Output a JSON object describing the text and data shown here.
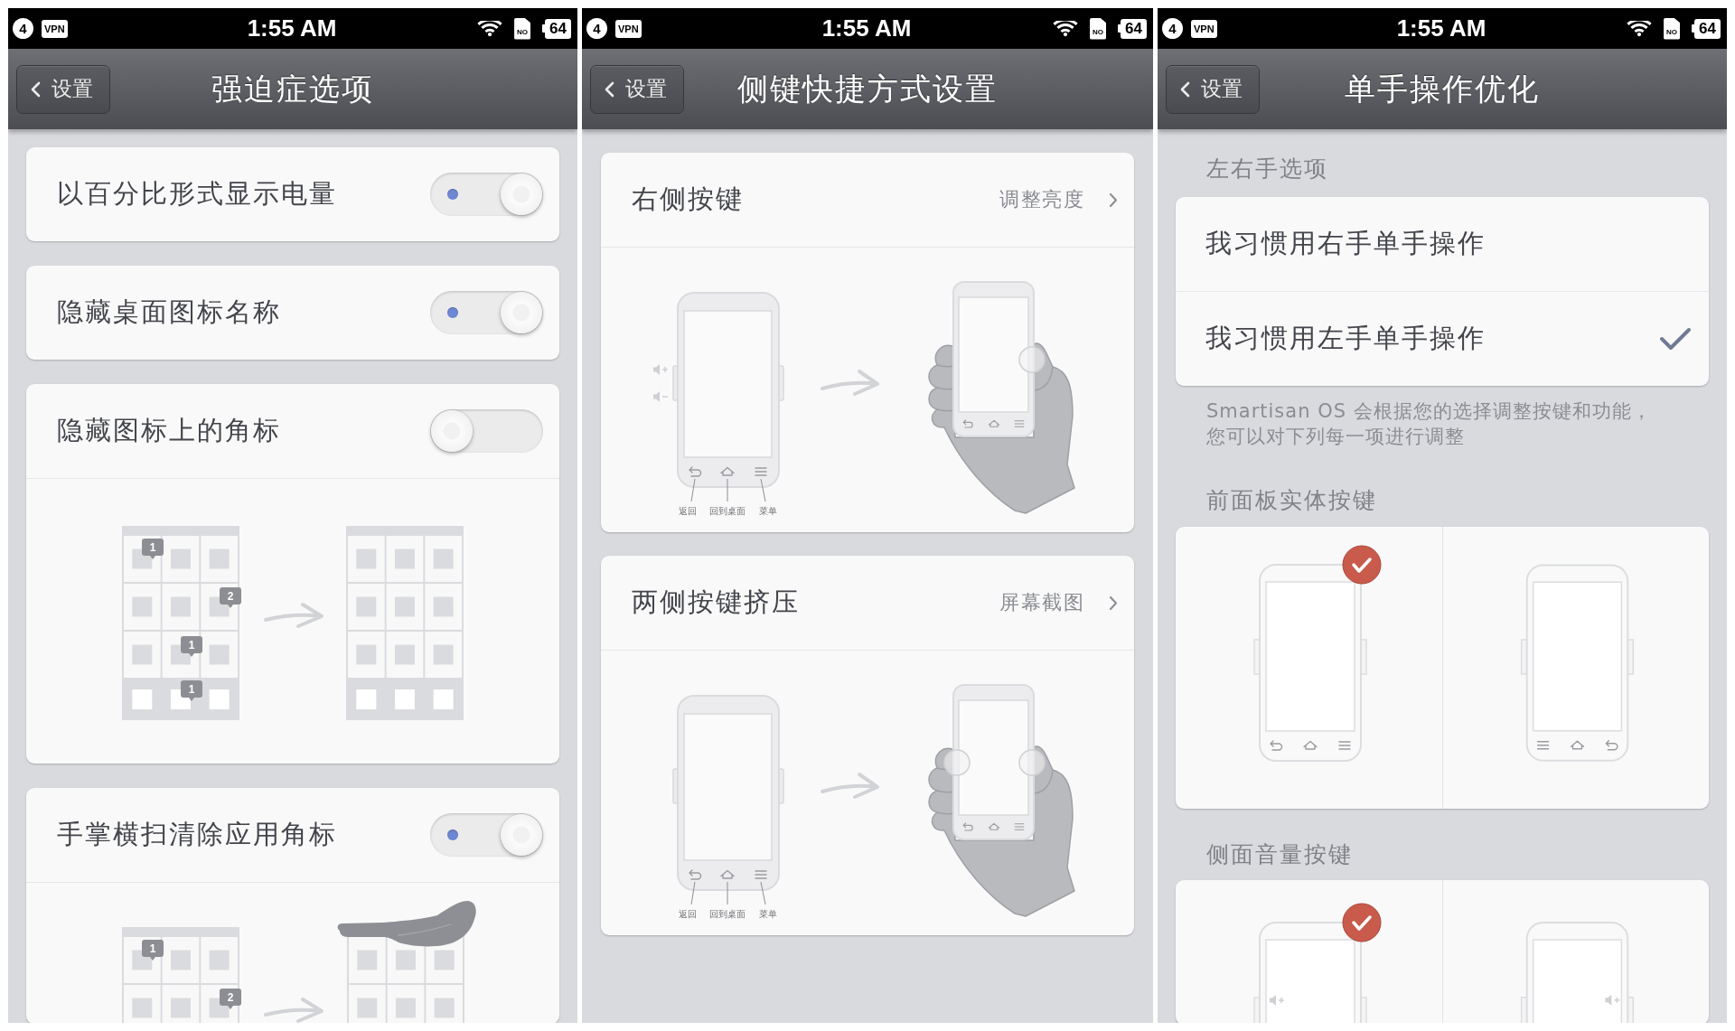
{
  "screens": [
    {
      "kind": "toggles",
      "status_bar": {
        "notifications": "4",
        "vpn": "VPN",
        "time": "1:55 AM",
        "sim": "NO",
        "battery": "64"
      },
      "nav_bar": {
        "back": "设置",
        "title": "强迫症选项"
      },
      "items": [
        {
          "label": "以百分比形式显示电量",
          "on": true
        },
        {
          "label": "隐藏桌面图标名称",
          "on": true
        },
        {
          "label": "隐藏图标上的角标",
          "on": false,
          "illustration": {
            "kind": "badge_clear",
            "badges": [
              "1",
              "2",
              "1",
              "1"
            ]
          }
        },
        {
          "label": "手掌横扫清除应用角标",
          "on": true,
          "illustration": {
            "kind": "palm_swipe",
            "badges": [
              "1",
              "2"
            ]
          }
        }
      ]
    },
    {
      "kind": "shortcuts",
      "status_bar": {
        "notifications": "4",
        "vpn": "VPN",
        "time": "1:55 AM",
        "sim": "NO",
        "battery": "64"
      },
      "nav_bar": {
        "back": "设置",
        "title": "侧键快捷方式设置"
      },
      "items": [
        {
          "label": "右侧按键",
          "value": "调整亮度",
          "illustration": {
            "kind": "one_side",
            "key_labels": [
              "返回",
              "回到桌面",
              "菜单"
            ]
          }
        },
        {
          "label": "两侧按键挤压",
          "value": "屏幕截图",
          "illustration": {
            "kind": "both_sides",
            "key_labels": [
              "返回",
              "回到桌面",
              "菜单"
            ]
          }
        }
      ]
    },
    {
      "kind": "hand_options",
      "status_bar": {
        "notifications": "4",
        "vpn": "VPN",
        "time": "1:55 AM",
        "sim": "NO",
        "battery": "64"
      },
      "nav_bar": {
        "back": "设置",
        "title": "单手操作优化"
      },
      "sections": [
        {
          "kind": "list",
          "title": "左右手选项",
          "options": [
            {
              "label": "我习惯用右手单手操作",
              "selected": false
            },
            {
              "label": "我习惯用左手单手操作",
              "selected": true
            }
          ],
          "note": "Smartisan OS 会根据您的选择调整按键和功能，您可以对下列每一项进行调整"
        },
        {
          "kind": "tiles",
          "title": "前面板实体按键",
          "tiles": [
            {
              "kind": "keys_back_left",
              "selected": true
            },
            {
              "kind": "keys_back_right",
              "selected": false
            }
          ]
        },
        {
          "kind": "tiles",
          "title": "侧面音量按键",
          "tiles": [
            {
              "kind": "volume_left",
              "selected": true
            },
            {
              "kind": "volume_right",
              "selected": false
            }
          ]
        }
      ]
    }
  ]
}
